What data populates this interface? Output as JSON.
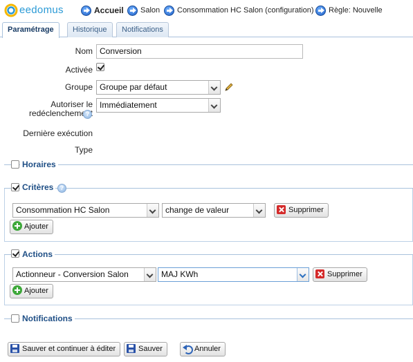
{
  "header": {
    "logo_text": "eedomus",
    "breadcrumbs": [
      "Accueil",
      "Salon",
      "Consommation HC Salon (configuration)",
      "Règle: Nouvelle"
    ]
  },
  "tabs": [
    "Paramétrage",
    "Historique",
    "Notifications"
  ],
  "form": {
    "nom_label": "Nom",
    "nom_value": "Conversion",
    "activee_label": "Activée",
    "activee_checked": true,
    "groupe_label": "Groupe",
    "groupe_value": "Groupe par défaut",
    "autoriser_label_1": "Autoriser le",
    "autoriser_label_2": "redéclenchement",
    "autoriser_value": "Immédiatement",
    "derniere_label": "Dernière exécution",
    "type_label": "Type"
  },
  "sections": {
    "horaires": {
      "title": "Horaires",
      "checked": false
    },
    "criteres": {
      "title": "Critères",
      "checked": true,
      "row": {
        "device": "Consommation HC Salon",
        "condition": "change de valeur",
        "delete_label": "Supprimer"
      },
      "add_label": "Ajouter"
    },
    "actions": {
      "title": "Actions",
      "checked": true,
      "row": {
        "device": "Actionneur - Conversion Salon",
        "value": "MAJ KWh",
        "delete_label": "Supprimer"
      },
      "add_label": "Ajouter"
    },
    "notifications": {
      "title": "Notifications",
      "checked": false
    }
  },
  "footer": {
    "save_continue_label": "Sauver et continuer à éditer",
    "save_label": "Sauver",
    "cancel_label": "Annuler"
  },
  "colors": {
    "accent": "#1f4f86",
    "logo": "#2b9ad6",
    "delete": "#d42a2a",
    "add": "#3ea83a"
  }
}
